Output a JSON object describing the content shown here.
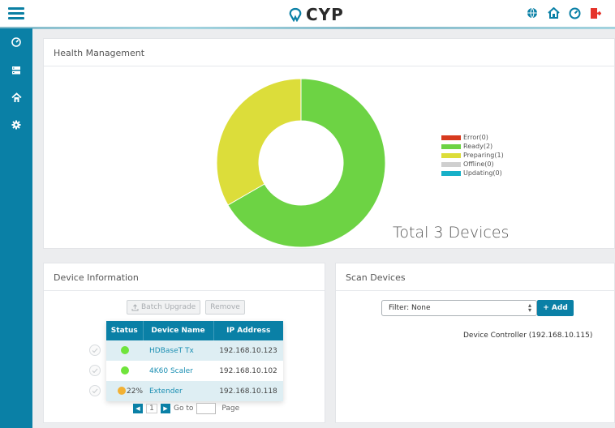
{
  "header": {
    "brand": "CYP",
    "icons": [
      "menu-icon",
      "globe-icon",
      "home-icon",
      "dashboard-icon",
      "logout-icon"
    ]
  },
  "sidebar": {
    "items": [
      "dashboard-icon",
      "device-list-icon",
      "home-settings-icon",
      "gear-icon"
    ]
  },
  "health": {
    "title": "Health Management",
    "total_label": "Total 3 Devices",
    "legend": [
      {
        "label": "Error(0)",
        "color": "#d73a1e"
      },
      {
        "label": "Ready(2)",
        "color": "#6dd344"
      },
      {
        "label": "Preparing(1)",
        "color": "#dcdd3a"
      },
      {
        "label": "Offline(0)",
        "color": "#cfcfcf"
      },
      {
        "label": "Updating(0)",
        "color": "#17b0c8"
      }
    ]
  },
  "chart_data": {
    "type": "pie",
    "categories": [
      "Error",
      "Ready",
      "Preparing",
      "Offline",
      "Updating"
    ],
    "values": [
      0,
      2,
      1,
      0,
      0
    ],
    "colors": [
      "#d73a1e",
      "#6dd344",
      "#dcdd3a",
      "#cfcfcf",
      "#17b0c8"
    ],
    "donut": true
  },
  "device_info": {
    "title": "Device Information",
    "batch_upgrade_label": "Batch Upgrade",
    "remove_label": "Remove",
    "columns": [
      "Status",
      "Device Name",
      "IP Address"
    ],
    "rows": [
      {
        "status_color": "#6fe43c",
        "status_text": "",
        "name": "HDBaseT Tx",
        "ip": "192.168.10.123"
      },
      {
        "status_color": "#6fe43c",
        "status_text": "",
        "name": "4K60 Scaler",
        "ip": "192.168.10.102"
      },
      {
        "status_color": "#f2b134",
        "status_text": "22%",
        "name": "Extender",
        "ip": "192.168.10.118"
      }
    ],
    "pager": {
      "page": "1",
      "goto_label": "Go to",
      "page_label": "Page"
    }
  },
  "scan": {
    "title": "Scan Devices",
    "filter_value": "Filter: None",
    "add_label": "+ Add",
    "controller_text": "Device Controller (192.168.10.115)"
  }
}
